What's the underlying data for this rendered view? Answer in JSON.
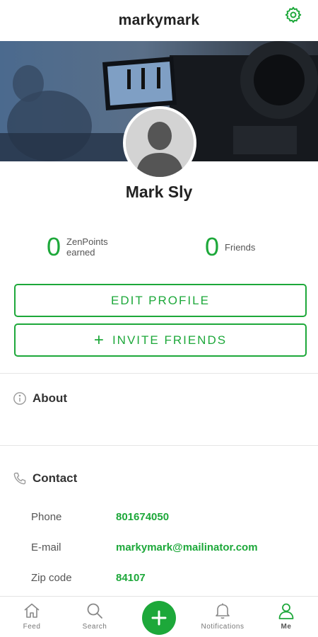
{
  "app": {
    "username": "markymark"
  },
  "icons": {
    "settings": "gear-icon",
    "info": "info-icon",
    "phone": "phone-icon",
    "fab": "plus-icon"
  },
  "colors": {
    "accent": "#1da83a"
  },
  "profile": {
    "name": "Mark Sly"
  },
  "stats": {
    "zenpoints": {
      "value": "0",
      "label_line1": "ZenPoints",
      "label_line2": "earned"
    },
    "friends": {
      "value": "0",
      "label": "Friends"
    }
  },
  "buttons": {
    "edit_profile": "EDIT PROFILE",
    "invite_friends": "INVITE FRIENDS",
    "invite_prefix": "+"
  },
  "about": {
    "title": "About"
  },
  "contact": {
    "title": "Contact",
    "rows": [
      {
        "label": "Phone",
        "value": "801674050"
      },
      {
        "label": "E-mail",
        "value": "markymark@mailinator.com"
      },
      {
        "label": "Zip code",
        "value": "84107"
      }
    ]
  },
  "nav": {
    "items": [
      {
        "label": "Feed",
        "icon": "home-icon"
      },
      {
        "label": "Search",
        "icon": "search-icon"
      },
      {
        "label": "",
        "icon": "plus-icon"
      },
      {
        "label": "Notifications",
        "icon": "bell-icon"
      },
      {
        "label": "Me",
        "icon": "person-icon"
      }
    ],
    "active": "Me"
  }
}
